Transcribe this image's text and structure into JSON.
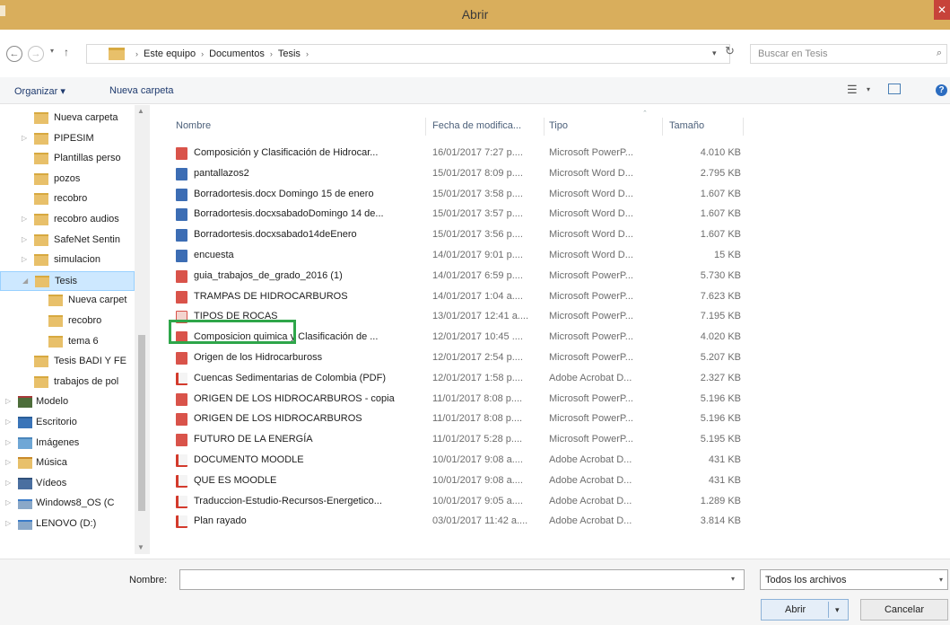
{
  "window": {
    "title": "Abrir",
    "close_glyph": "✕"
  },
  "nav": {
    "back_glyph": "←",
    "forward_glyph": "→",
    "recent_glyph": "▾",
    "up_glyph": "↑",
    "refresh_glyph": "↻"
  },
  "address": {
    "crumbs": [
      "Este equipo",
      "Documentos",
      "Tesis"
    ],
    "sep": "›"
  },
  "search": {
    "placeholder": "Buscar en Tesis",
    "icon": "search-icon",
    "glyph": "⌕"
  },
  "toolbar": {
    "organize": "Organizar ▾",
    "new_folder": "Nueva carpeta",
    "view_glyph": "☰",
    "help_glyph": "?"
  },
  "sidebar": {
    "items": [
      {
        "label": "Nueva carpeta",
        "icon": "folder-icon",
        "expandable": false
      },
      {
        "label": "PIPESIM",
        "icon": "folder-icon",
        "expandable": true
      },
      {
        "label": "Plantillas perso",
        "icon": "folder-icon",
        "expandable": false
      },
      {
        "label": "pozos",
        "icon": "folder-icon",
        "expandable": false
      },
      {
        "label": "recobro",
        "icon": "folder-icon",
        "expandable": false
      },
      {
        "label": "recobro audios",
        "icon": "folder-icon",
        "expandable": true
      },
      {
        "label": "SafeNet Sentin",
        "icon": "folder-icon",
        "expandable": true
      },
      {
        "label": "simulacion",
        "icon": "folder-icon",
        "expandable": true
      },
      {
        "label": "Tesis",
        "icon": "folder-icon",
        "expandable": true,
        "selected": true
      },
      {
        "label": "Nueva carpet",
        "icon": "folder-icon",
        "expandable": false
      },
      {
        "label": "recobro",
        "icon": "folder-icon",
        "expandable": false
      },
      {
        "label": "tema 6",
        "icon": "folder-icon",
        "expandable": false
      },
      {
        "label": "Tesis BADI Y FE",
        "icon": "folder-icon",
        "expandable": false
      },
      {
        "label": "trabajos de pol",
        "icon": "folder-icon",
        "expandable": false
      },
      {
        "label": "Modelo",
        "icon": "library-icon",
        "expandable": true
      },
      {
        "label": "Escritorio",
        "icon": "desktop-icon",
        "expandable": true
      },
      {
        "label": "Imágenes",
        "icon": "pictures-icon",
        "expandable": true
      },
      {
        "label": "Música",
        "icon": "music-icon",
        "expandable": true
      },
      {
        "label": "Vídeos",
        "icon": "videos-icon",
        "expandable": true
      },
      {
        "label": "Windows8_OS (C",
        "icon": "drive-icon",
        "expandable": true
      },
      {
        "label": "LENOVO (D:)",
        "icon": "drive-icon",
        "expandable": true
      }
    ]
  },
  "columns": {
    "name": "Nombre",
    "date": "Fecha de modifica...",
    "type": "Tipo",
    "size": "Tamaño"
  },
  "files": [
    {
      "name": "Composición y Clasificación de Hidrocar...",
      "date": "16/01/2017 7:27 p....",
      "type": "Microsoft PowerP...",
      "size": "4.010 KB",
      "icon": "powerpoint-icon"
    },
    {
      "name": "pantallazos2",
      "date": "15/01/2017 8:09 p....",
      "type": "Microsoft Word D...",
      "size": "2.795 KB",
      "icon": "word-icon"
    },
    {
      "name": "Borradortesis.docx Domingo 15 de enero",
      "date": "15/01/2017 3:58 p....",
      "type": "Microsoft Word D...",
      "size": "1.607 KB",
      "icon": "word-icon"
    },
    {
      "name": "Borradortesis.docxsabadoDomingo 14 de...",
      "date": "15/01/2017 3:57 p....",
      "type": "Microsoft Word D...",
      "size": "1.607 KB",
      "icon": "word-icon"
    },
    {
      "name": "Borradortesis.docxsabado14deEnero",
      "date": "15/01/2017 3:56 p....",
      "type": "Microsoft Word D...",
      "size": "1.607 KB",
      "icon": "word-icon"
    },
    {
      "name": "encuesta",
      "date": "14/01/2017 9:01 p....",
      "type": "Microsoft Word D...",
      "size": "15 KB",
      "icon": "word-icon"
    },
    {
      "name": "guia_trabajos_de_grado_2016 (1)",
      "date": "14/01/2017 6:59 p....",
      "type": "Microsoft PowerP...",
      "size": "5.730 KB",
      "icon": "powerpoint-icon"
    },
    {
      "name": "TRAMPAS DE HIDROCARBUROS",
      "date": "14/01/2017 1:04 a....",
      "type": "Microsoft PowerP...",
      "size": "7.623 KB",
      "icon": "powerpoint-icon"
    },
    {
      "name": "TIPOS DE ROCAS",
      "date": "13/01/2017 12:41 a....",
      "type": "Microsoft PowerP...",
      "size": "7.195 KB",
      "icon": "powerpoint-open-icon"
    },
    {
      "name": "Composicion quimica y Clasificación de ...",
      "date": "12/01/2017 10:45 ....",
      "type": "Microsoft PowerP...",
      "size": "4.020 KB",
      "icon": "powerpoint-icon"
    },
    {
      "name": "Origen de los Hidrocarbuross",
      "date": "12/01/2017 2:54 p....",
      "type": "Microsoft PowerP...",
      "size": "5.207 KB",
      "icon": "powerpoint-icon"
    },
    {
      "name": "Cuencas Sedimentarias de Colombia (PDF)",
      "date": "12/01/2017 1:58 p....",
      "type": "Adobe Acrobat D...",
      "size": "2.327 KB",
      "icon": "pdf-icon"
    },
    {
      "name": "ORIGEN DE LOS HIDROCARBUROS - copia",
      "date": "11/01/2017 8:08 p....",
      "type": "Microsoft PowerP...",
      "size": "5.196 KB",
      "icon": "powerpoint-icon"
    },
    {
      "name": "ORIGEN DE LOS HIDROCARBUROS",
      "date": "11/01/2017 8:08 p....",
      "type": "Microsoft PowerP...",
      "size": "5.196 KB",
      "icon": "powerpoint-icon"
    },
    {
      "name": "FUTURO DE LA ENERGÍA",
      "date": "11/01/2017 5:28 p....",
      "type": "Microsoft PowerP...",
      "size": "5.195 KB",
      "icon": "powerpoint-icon"
    },
    {
      "name": "DOCUMENTO MOODLE",
      "date": "10/01/2017 9:08 a....",
      "type": "Adobe Acrobat D...",
      "size": "431 KB",
      "icon": "pdf-icon"
    },
    {
      "name": "QUE ES MOODLE",
      "date": "10/01/2017 9:08 a....",
      "type": "Adobe Acrobat D...",
      "size": "431 KB",
      "icon": "pdf-icon"
    },
    {
      "name": "Traduccion-Estudio-Recursos-Energetico...",
      "date": "10/01/2017 9:05 a....",
      "type": "Adobe Acrobat D...",
      "size": "1.289 KB",
      "icon": "pdf-icon"
    },
    {
      "name": "Plan rayado",
      "date": "03/01/2017 11:42 a....",
      "type": "Adobe Acrobat D...",
      "size": "3.814 KB",
      "icon": "pdf-icon"
    }
  ],
  "bottom": {
    "filename_label": "Nombre:",
    "filename_value": "",
    "filter": "Todos los archivos",
    "open": "Abrir",
    "cancel": "Cancelar",
    "dropdown_glyph": "▾"
  },
  "colors": {
    "titlebar": "#d9ae5c",
    "selection": "#cde8ff",
    "highlight_box": "#2ea64a"
  }
}
